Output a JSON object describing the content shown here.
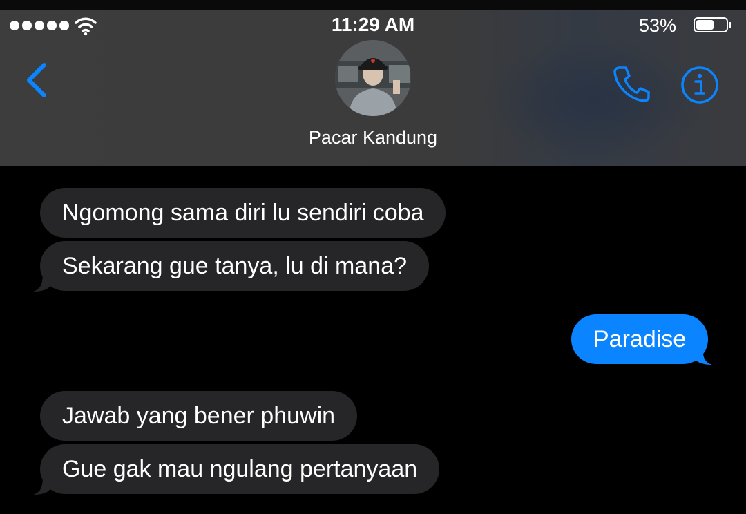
{
  "status_bar": {
    "time": "11:29 AM",
    "battery_percent": "53%",
    "battery_level": 0.53,
    "signal_dots": 5
  },
  "nav": {
    "contact_name": "Pacar Kandung",
    "back_icon": "chevron-left-icon",
    "call_icon": "phone-icon",
    "info_icon": "info-icon"
  },
  "colors": {
    "accent": "#0a84ff",
    "incoming_bubble": "#262628",
    "header_bg": "#3d3d3d",
    "background": "#000000"
  },
  "messages": [
    {
      "direction": "incoming",
      "text": "Ngomong sama diri lu sendiri coba"
    },
    {
      "direction": "incoming",
      "text": "Sekarang gue tanya, lu di mana?"
    },
    {
      "direction": "outgoing",
      "text": "Paradise"
    },
    {
      "direction": "incoming",
      "text": "Jawab yang bener phuwin"
    },
    {
      "direction": "incoming",
      "text": "Gue gak mau ngulang pertanyaan"
    }
  ]
}
